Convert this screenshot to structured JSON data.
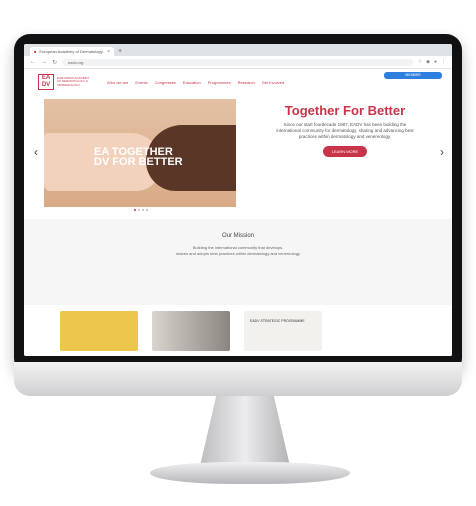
{
  "browser": {
    "tab_title": "European Academy of Dermatology and Venereology",
    "new_tab": "+",
    "url": "eadv.org",
    "nav": {
      "back": "←",
      "forward": "→",
      "reload": "↻"
    }
  },
  "header": {
    "logo_mark_top": "EA",
    "logo_mark_bottom": "DV",
    "logo_text": "EUROPEAN ACADEMY OF DERMATOLOGY & VENEREOLOGY",
    "nav_items": [
      "Who we are",
      "Events",
      "Congresses",
      "Education",
      "Programmes",
      "Research",
      "Get Involved"
    ],
    "button_label": "MEMBER"
  },
  "hero": {
    "image_logo_top": "EA TOGETHER",
    "image_logo_bottom": "DV FOR BETTER",
    "title": "Together For Better",
    "body": "Since our start fourdecade 1987, EADV has been building the international community for dermatology, sharing and advancing best practices within dermatology and venereology.",
    "button_label": "LEARN MORE",
    "arrow_left": "‹",
    "arrow_right": "›"
  },
  "mission": {
    "title": "Our Mission",
    "body_line1": "Building the international community that develops,",
    "body_line2": "shares and adopts best practices within dermatology and venereology"
  },
  "cards": {
    "third_label": "EADV STRATEGIC PROGRAMME"
  },
  "colors": {
    "accent": "#c8344a",
    "button_blue": "#2f7fe0",
    "hero_bg": "#dcb08e"
  }
}
